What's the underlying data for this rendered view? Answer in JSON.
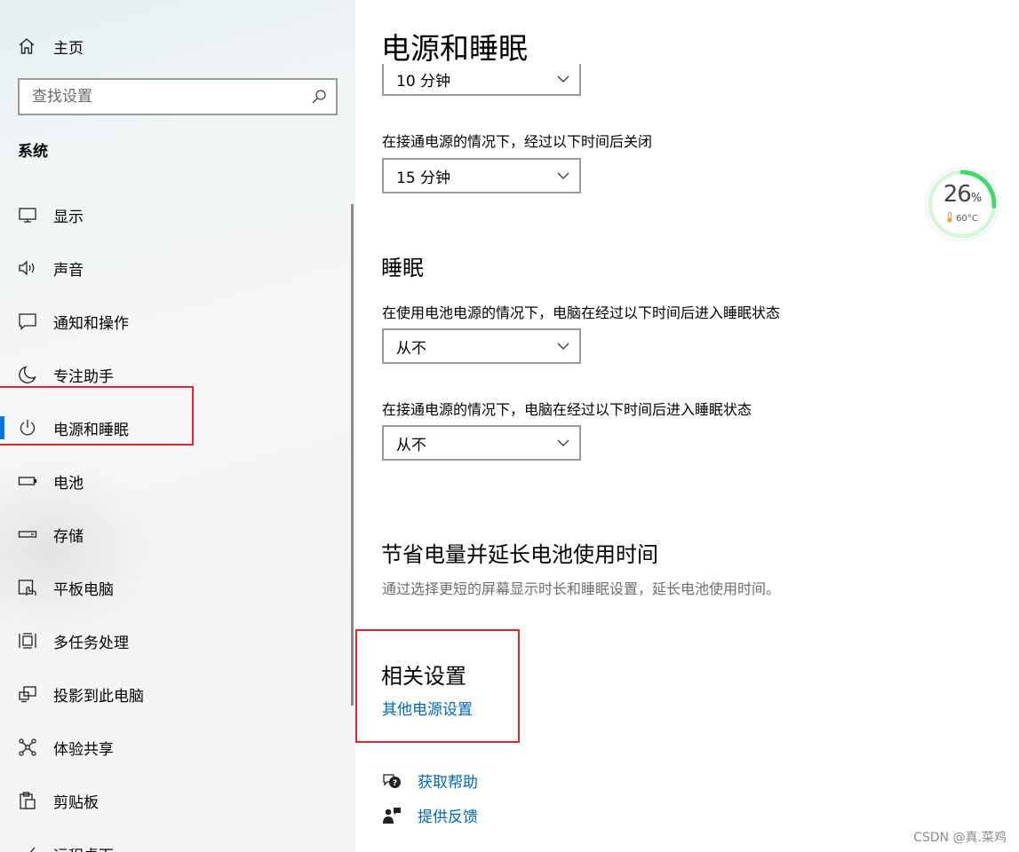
{
  "sidebar": {
    "home_label": "主页",
    "search_placeholder": "查找设置",
    "section_title": "系统",
    "items": [
      {
        "label": "显示",
        "icon": "monitor-icon"
      },
      {
        "label": "声音",
        "icon": "speaker-icon"
      },
      {
        "label": "通知和操作",
        "icon": "notification-icon"
      },
      {
        "label": "专注助手",
        "icon": "moon-icon"
      },
      {
        "label": "电源和睡眠",
        "icon": "power-icon",
        "active": true
      },
      {
        "label": "电池",
        "icon": "battery-icon"
      },
      {
        "label": "存储",
        "icon": "storage-icon"
      },
      {
        "label": "平板电脑",
        "icon": "tablet-icon"
      },
      {
        "label": "多任务处理",
        "icon": "multitask-icon"
      },
      {
        "label": "投影到此电脑",
        "icon": "project-icon"
      },
      {
        "label": "体验共享",
        "icon": "share-icon"
      },
      {
        "label": "剪贴板",
        "icon": "clipboard-icon"
      },
      {
        "label": "远程桌面",
        "icon": "remote-icon"
      }
    ],
    "accent_color": "#0078d7"
  },
  "main": {
    "title": "电源和睡眠",
    "screen": {
      "battery_value": "10 分钟",
      "plugged_label": "在接通电源的情况下，经过以下时间后关闭",
      "plugged_value": "15 分钟"
    },
    "sleep": {
      "heading": "睡眠",
      "battery_label": "在使用电池电源的情况下，电脑在经过以下时间后进入睡眠状态",
      "battery_value": "从不",
      "plugged_label": "在接通电源的情况下，电脑在经过以下时间后进入睡眠状态",
      "plugged_value": "从不"
    },
    "save": {
      "heading": "节省电量并延长电池使用时间",
      "description": "通过选择更短的屏幕显示时长和睡眠设置，延长电池使用时间。"
    },
    "related": {
      "heading": "相关设置",
      "link": "其他电源设置"
    },
    "help": {
      "get_help": "获取帮助",
      "feedback": "提供反馈"
    },
    "link_color": "#0067b8"
  },
  "widget": {
    "percent": 26,
    "percent_unit": "%",
    "temperature": "60°C",
    "ring_color": "#3ddc6a"
  },
  "watermark": "CSDN @真.菜鸡"
}
